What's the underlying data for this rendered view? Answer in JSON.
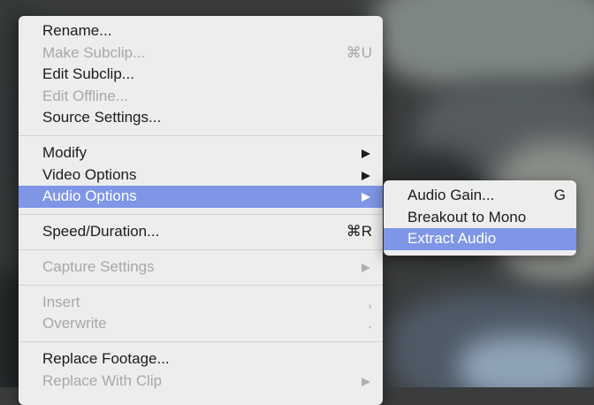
{
  "menu": {
    "groups": [
      [
        {
          "label": "Rename...",
          "shortcut": "",
          "disabled": false,
          "submenu": false
        },
        {
          "label": "Make Subclip...",
          "shortcut": "⌘U",
          "disabled": true,
          "submenu": false
        },
        {
          "label": "Edit Subclip...",
          "shortcut": "",
          "disabled": false,
          "submenu": false
        },
        {
          "label": "Edit Offline...",
          "shortcut": "",
          "disabled": true,
          "submenu": false
        },
        {
          "label": "Source Settings...",
          "shortcut": "",
          "disabled": false,
          "submenu": false
        }
      ],
      [
        {
          "label": "Modify",
          "shortcut": "",
          "disabled": false,
          "submenu": true
        },
        {
          "label": "Video Options",
          "shortcut": "",
          "disabled": false,
          "submenu": true
        },
        {
          "label": "Audio Options",
          "shortcut": "",
          "disabled": false,
          "submenu": true,
          "selected": true
        }
      ],
      [
        {
          "label": "Speed/Duration...",
          "shortcut": "⌘R",
          "disabled": false,
          "submenu": false
        }
      ],
      [
        {
          "label": "Capture Settings",
          "shortcut": "",
          "disabled": true,
          "submenu": true
        }
      ],
      [
        {
          "label": "Insert",
          "shortcut": ",",
          "disabled": true,
          "submenu": false
        },
        {
          "label": "Overwrite",
          "shortcut": ".",
          "disabled": true,
          "submenu": false
        }
      ],
      [
        {
          "label": "Replace Footage...",
          "shortcut": "",
          "disabled": false,
          "submenu": false
        },
        {
          "label": "Replace With Clip",
          "shortcut": "",
          "disabled": true,
          "submenu": true
        }
      ]
    ]
  },
  "submenu": {
    "items": [
      {
        "label": "Audio Gain...",
        "shortcut": "G",
        "disabled": false,
        "selected": false
      },
      {
        "label": "Breakout to Mono",
        "shortcut": "",
        "disabled": false,
        "selected": false
      },
      {
        "label": "Extract Audio",
        "shortcut": "",
        "disabled": false,
        "selected": true
      }
    ]
  },
  "colors": {
    "menu_bg": "#ededed",
    "highlight": "#7f96e6",
    "text": "#1c1c1c",
    "disabled_text": "#a8a8a8"
  }
}
